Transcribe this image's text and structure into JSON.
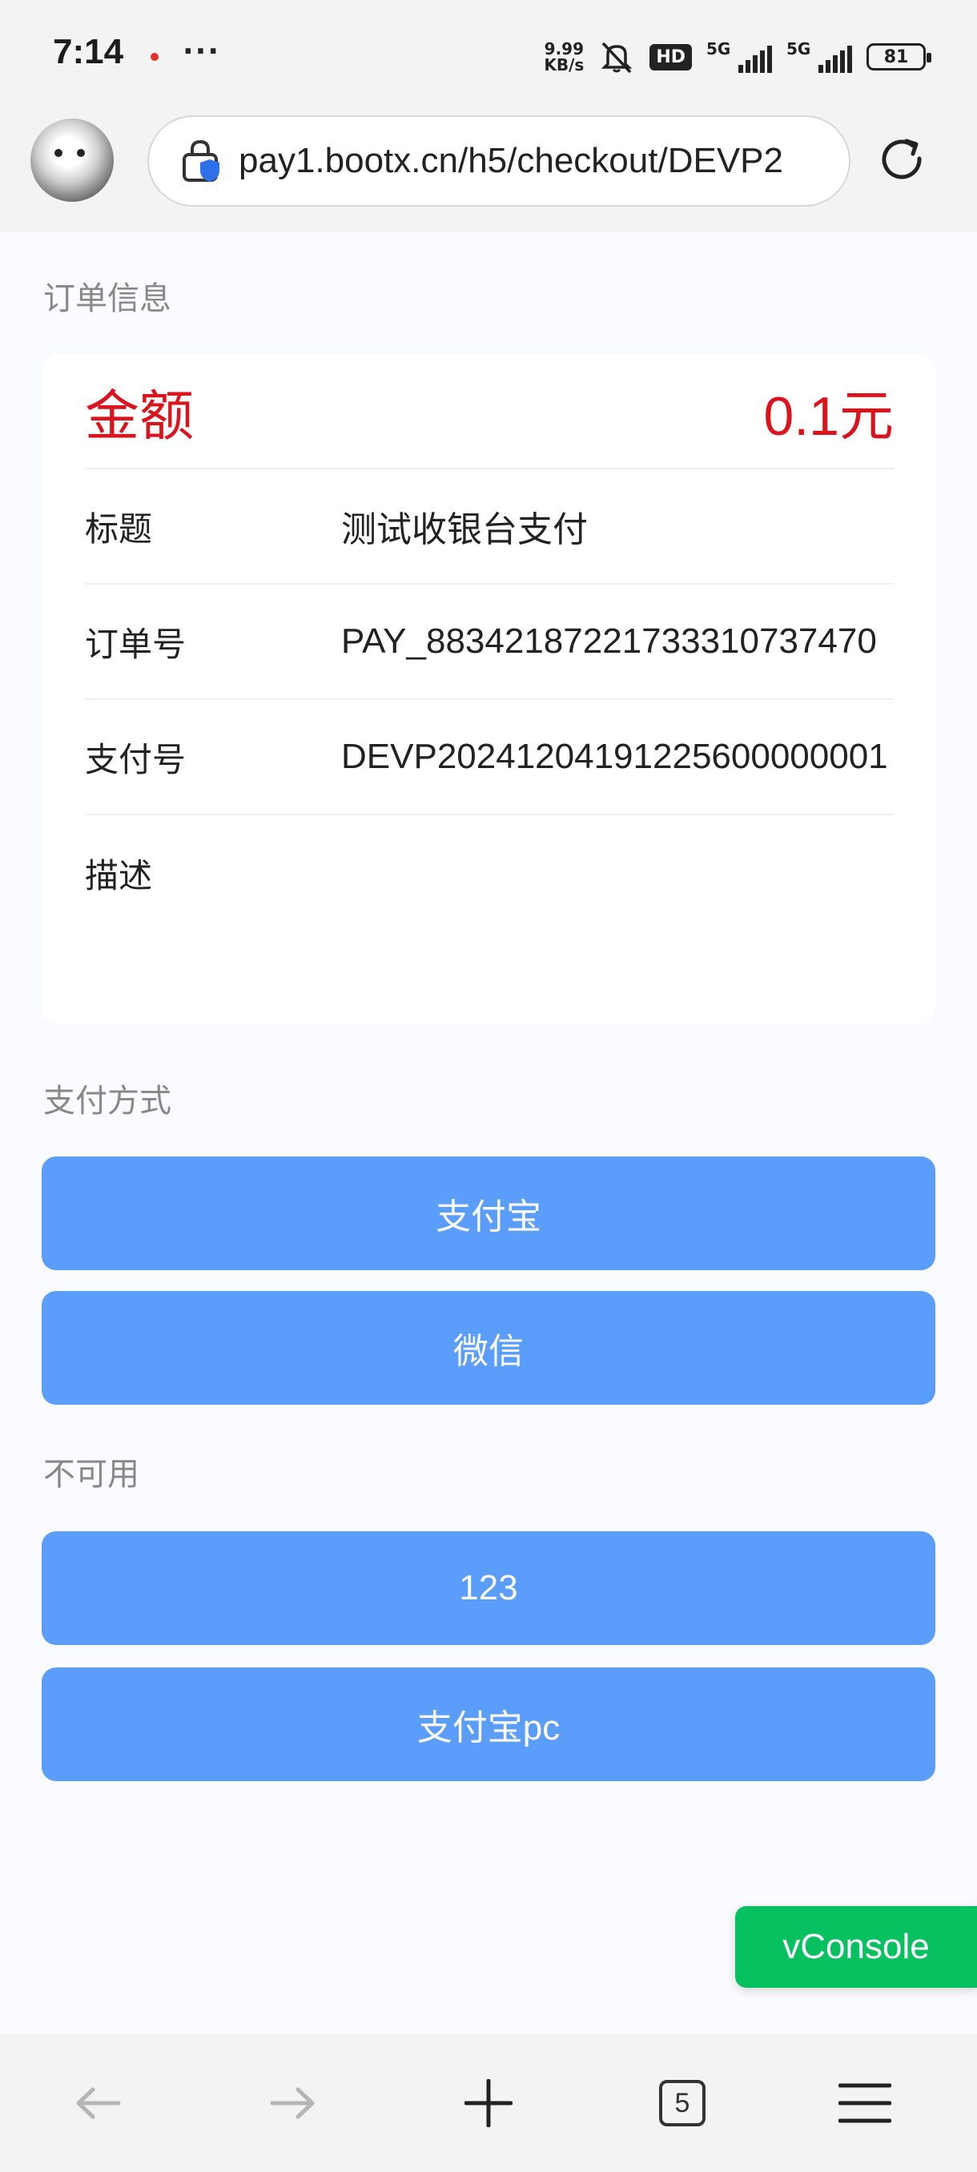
{
  "status_bar": {
    "time": "7:14",
    "more": "···",
    "net_speed_value": "9.99",
    "net_speed_unit": "KB/s",
    "hd_label": "HD",
    "signal1_label": "5G",
    "signal2_label": "5G",
    "battery": "81"
  },
  "browser": {
    "url": "pay1.bootx.cn/h5/checkout/DEVP2"
  },
  "order": {
    "section_title": "订单信息",
    "amount_label": "金额",
    "amount_value": "0.1元",
    "rows": [
      {
        "key": "标题",
        "value": "测试收银台支付"
      },
      {
        "key": "订单号",
        "value": "PAY_883421872217333107374​70"
      },
      {
        "key": "支付号",
        "value": "DEVP20241204191225600000001"
      },
      {
        "key": "描述",
        "value": ""
      }
    ]
  },
  "payment": {
    "section_title": "支付方式",
    "methods": [
      "支付宝",
      "微信"
    ]
  },
  "unavailable": {
    "section_title": "不可用",
    "methods": [
      "123",
      "支付宝pc"
    ]
  },
  "vconsole_label": "vConsole",
  "bottom_nav": {
    "tab_count": "5"
  },
  "colors": {
    "amount_red": "#d9141e",
    "button_blue": "#5b9dfa",
    "vconsole_green": "#07c160"
  }
}
